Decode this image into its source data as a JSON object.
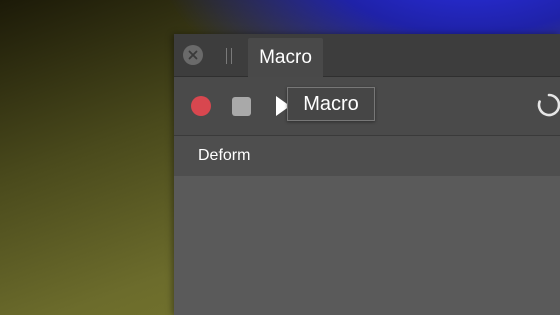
{
  "panel": {
    "tab_label": "Macro",
    "close_icon": "close-icon",
    "grip_icon": "drag-grip-icon"
  },
  "toolbar": {
    "record_icon": "record-icon",
    "stop_icon": "stop-icon",
    "play_icon": "play-icon",
    "tooltip_text": "Macro",
    "spinner_icon": "loading-spinner-icon"
  },
  "section": {
    "label": "Deform"
  },
  "colors": {
    "record": "#d8474f",
    "panel_bg": "#595959",
    "tabbar_bg": "#3d3d3d"
  }
}
